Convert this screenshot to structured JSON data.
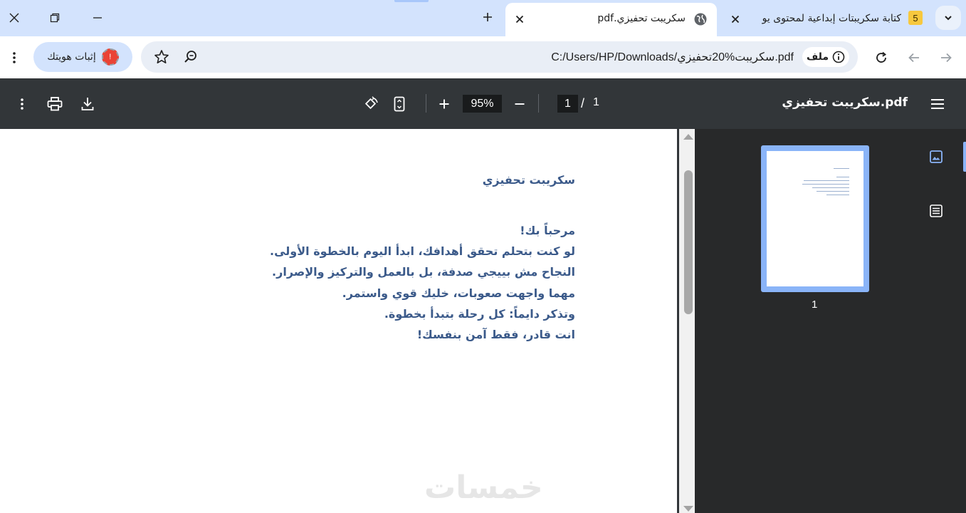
{
  "tabs": [
    {
      "title": "سكريبت تحفيزي.pdf",
      "active": true
    },
    {
      "title": "كتابة سكريبتات إبداعية لمحتوى يو",
      "active": false,
      "badge": "5"
    }
  ],
  "toolbar": {
    "site_chip_label": "ملف",
    "url": "C:/Users/HP/Downloads/سكريبت%20تحفيزي.pdf",
    "identity_label": "إثبات هويتك",
    "avatar_badge": "!"
  },
  "pdf": {
    "title": "سكريبت تحفيزي.pdf",
    "zoom": "95%",
    "current_page": "1",
    "page_separator": "/",
    "total_pages": "1",
    "thumbnail_label": "1"
  },
  "document": {
    "title": "سكريبت تحفيزي",
    "lines": [
      "مرحباً بك!",
      "لو كنت بتحلم تحقق أهدافك، ابدأ اليوم بالخطوة الأولى.",
      "النجاح مش بييجي صدفة، بل بالعمل والتركيز والإصرار.",
      "مهما واجهت صعوبات، خليك قوي واستمر.",
      "وتذكر دايماً: كل رحلة بتبدأ بخطوة.",
      "انت قادر، فقط آمن بنفسك!"
    ]
  },
  "watermark": "خمسات",
  "colors": {
    "pdf_toolbar": "#323639",
    "sidebar": "#28292a",
    "doc_text": "#3b5a8a",
    "tabstrip": "#d3e3fd",
    "accent": "#8ab4f8"
  }
}
